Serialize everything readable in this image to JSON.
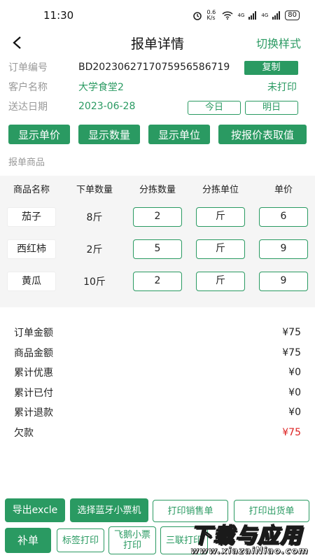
{
  "status_bar": {
    "time": "11:30",
    "alarm_icon": "alarm-icon",
    "speed": "0.6 K/s",
    "wifi_icon": "wifi-icon",
    "signal1": "4G",
    "signal2": "4G",
    "battery": "80"
  },
  "header": {
    "title": "报单详情",
    "back_icon": "chevron-left-icon",
    "switch_label": "切换样式"
  },
  "info": {
    "order_no_label": "订单编号",
    "order_no": "BD202306271707595658​6719",
    "copy_label": "复制",
    "customer_label": "客户名称",
    "customer": "大学食堂2",
    "print_status": "未打印",
    "delivery_label": "送达日期",
    "delivery_date": "2023-06-28",
    "today_label": "今日",
    "tomorrow_label": "明日"
  },
  "actions": {
    "show_price": "显示单价",
    "show_qty": "显示数量",
    "show_unit": "显示单位",
    "by_price_table": "按报价表取值"
  },
  "products_section": "报单商品",
  "table": {
    "headers": [
      "商品名称",
      "下单数量",
      "分拣数量",
      "分拣单位",
      "单价"
    ],
    "rows": [
      {
        "name": "茄子",
        "order_qty": "8斤",
        "sort_qty": "2",
        "sort_unit": "斤",
        "price": "6"
      },
      {
        "name": "西红柿",
        "order_qty": "2斤",
        "sort_qty": "5",
        "sort_unit": "斤",
        "price": "9"
      },
      {
        "name": "黄瓜",
        "order_qty": "10斤",
        "sort_qty": "2",
        "sort_unit": "斤",
        "price": "9"
      }
    ]
  },
  "summary": {
    "order_amount_label": "订单金额",
    "order_amount": "¥75",
    "goods_amount_label": "商品金额",
    "goods_amount": "¥75",
    "discount_label": "累计优惠",
    "discount": "¥0",
    "paid_label": "累计已付",
    "paid": "¥0",
    "refund_label": "累计退款",
    "refund": "¥0",
    "owed_label": "欠款",
    "owed": "¥75",
    "owed_color": "#dd2222"
  },
  "bottom": {
    "export_excel": "导出excle",
    "select_printer": "选择蓝牙小票机",
    "print_sales": "打印销售单",
    "print_delivery": "打印出货单",
    "supplement": "补单",
    "label_print": "标签打印",
    "feie_print": "飞鹅小票打印",
    "triple_print": "三联打印"
  },
  "watermark": {
    "main": "下载与应用",
    "sub": "www.xiazaiNiao.com"
  },
  "colors": {
    "accent": "#2a9a62",
    "muted": "#999999",
    "red": "#dd2222"
  }
}
